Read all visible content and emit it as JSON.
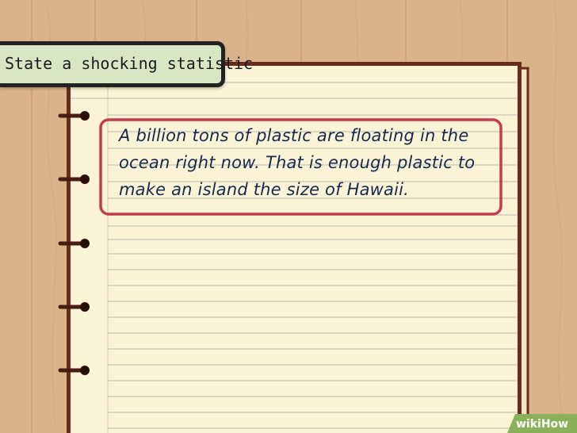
{
  "label": {
    "text": "State a shocking statistic"
  },
  "note": {
    "text": "A billion tons of plastic are floating in the ocean right now. That is enough plastic to make an island the size of Hawaii."
  },
  "watermark": {
    "wiki": "wiki",
    "how": "How"
  },
  "colors": {
    "background_wood": "#d9b48a",
    "paper": "#fbf3d6",
    "paper_back": "#f3e7c3",
    "ruled_line": "#c7c4b6",
    "margin_line": "#d8d4c8",
    "frame": "#6b2b1c",
    "highlight_box": "#c43c4b",
    "note_text": "#152a52",
    "label_tab": "#d8e6c4",
    "watermark_bg": "#8ab15a"
  }
}
